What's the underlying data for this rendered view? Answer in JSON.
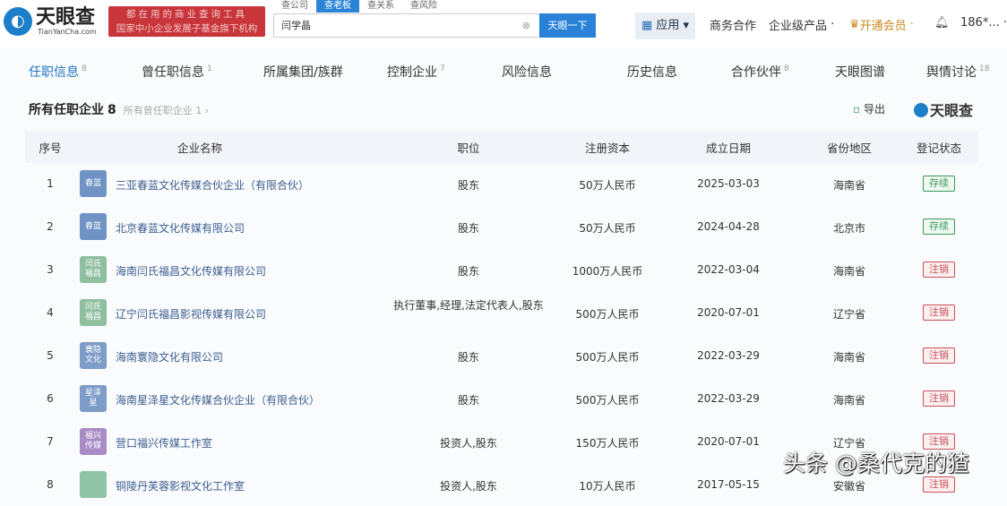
{
  "header": {
    "logo_cn": "天眼查",
    "logo_en": "TianYanCha.com",
    "ad_line1": "都在用的商业查询工具",
    "ad_line2": "国家中小企业发展子基金旗下机构",
    "search_tabs": [
      "查公司",
      "查老板",
      "查关系",
      "查风险"
    ],
    "active_search_tab": 1,
    "search_value": "闫学晶",
    "search_button": "天眼一下",
    "nav": {
      "apps": "应用",
      "business": "商务合作",
      "enterprise": "企业级产品",
      "vip": "开通会员",
      "user": "186*..."
    }
  },
  "tabs": [
    {
      "label": "任职信息",
      "count": "8"
    },
    {
      "label": "曾任职信息",
      "count": "1"
    },
    {
      "label": "所属集团/族群",
      "count": ""
    },
    {
      "label": "控制企业",
      "count": "7"
    },
    {
      "label": "风险信息",
      "count": ""
    },
    {
      "label": "历史信息",
      "count": ""
    },
    {
      "label": "合作伙伴",
      "count": "8"
    },
    {
      "label": "天眼图谱",
      "count": ""
    },
    {
      "label": "舆情讨论",
      "count": "18"
    }
  ],
  "section": {
    "title": "所有任职企业",
    "count": "8",
    "other": "所有曾任职企业 1 ›",
    "export": "导出",
    "brand": "天眼查"
  },
  "columns": [
    "序号",
    "企业名称",
    "职位",
    "注册资本",
    "成立日期",
    "省份地区",
    "登记状态"
  ],
  "rows": [
    {
      "no": "1",
      "icon": "春蓝",
      "name": "三亚春蓝文化传媒合伙企业（有限合伙）",
      "role": "股东",
      "capital": "50万人民币",
      "date": "2025-03-03",
      "region": "海南省",
      "status": "存续"
    },
    {
      "no": "2",
      "icon": "春蓝",
      "name": "北京春蓝文化传媒有限公司",
      "role": "股东",
      "capital": "50万人民币",
      "date": "2024-04-28",
      "region": "北京市",
      "status": "存续"
    },
    {
      "no": "3",
      "icon": "闫氏福昌",
      "name": "海南闫氏福昌文化传媒有限公司",
      "role": "股东",
      "capital": "1000万人民币",
      "date": "2022-03-04",
      "region": "海南省",
      "status": "注销"
    },
    {
      "no": "4",
      "icon": "闫氏福昌",
      "name": "辽宁闫氏福昌影视传媒有限公司",
      "role": "执行董事,经理,法定代表人,股东",
      "capital": "500万人民币",
      "date": "2020-07-01",
      "region": "辽宁省",
      "status": "注销"
    },
    {
      "no": "5",
      "icon": "寰隐文化",
      "name": "海南寰隐文化有限公司",
      "role": "股东",
      "capital": "500万人民币",
      "date": "2022-03-29",
      "region": "海南省",
      "status": "注销"
    },
    {
      "no": "6",
      "icon": "星泽星",
      "name": "海南星泽星文化传媒合伙企业（有限合伙）",
      "role": "股东",
      "capital": "500万人民币",
      "date": "2022-03-29",
      "region": "海南省",
      "status": "注销"
    },
    {
      "no": "7",
      "icon": "福兴传媒",
      "name": "营口福兴传媒工作室",
      "role": "投资人,股东",
      "capital": "150万人民币",
      "date": "2020-07-01",
      "region": "辽宁省",
      "status": "注销"
    },
    {
      "no": "8",
      "icon": "",
      "name": "铜陵丹芙蓉影视文化工作室",
      "role": "投资人,股东",
      "capital": "10万人民币",
      "date": "2017-05-15",
      "region": "安徽省",
      "status": "注销"
    }
  ],
  "icon_colors": [
    "#6f93c4",
    "#6f93c4",
    "#8fbf9f",
    "#8fbf9f",
    "#7d9cc8",
    "#7d9cc8",
    "#a98cc6",
    "#8fc4a6"
  ],
  "status_colors": {
    "存续": "#3a9a5b",
    "注销": "#c9505a"
  },
  "watermark": "头条 @桑代克的猹"
}
